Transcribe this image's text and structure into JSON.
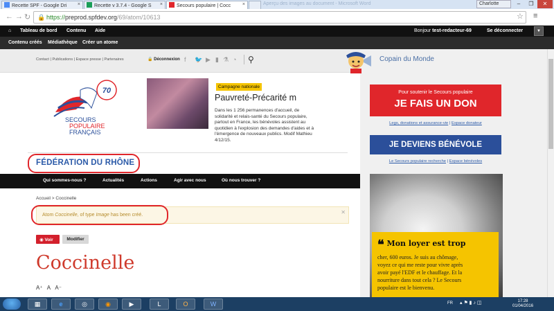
{
  "browser": {
    "tabs": [
      {
        "label": "Recette SPF - Google Dri",
        "active": false
      },
      {
        "label": "Recette v 3.7.4 - Google S",
        "active": false
      },
      {
        "label": "Secours populaire | Cocc",
        "active": true
      }
    ],
    "ghost_title": "Aperçu des images au document - Microsoft Word",
    "window_user": "Charlotte",
    "url_scheme": "https://",
    "url_host": "preprod.spfdev.org",
    "url_path": "/69/atom/10613"
  },
  "admin_bar": {
    "dashboard": "Tableau de bord",
    "content": "Contenu",
    "help": "Aide",
    "greeting": "Bonjour",
    "username": "test-redacteur-69",
    "logout": "Se déconnecter"
  },
  "admin_sub": {
    "created": "Contenu créés",
    "media": "Médiathèque",
    "create_atom": "Créer un atome"
  },
  "utility": {
    "links": "Contact  |  Publications  |  Espace presse  |  Partenaires",
    "logout": "Déconnexion",
    "copain": "Copain du Monde"
  },
  "news": {
    "badge": "Campagne nationale",
    "title": "Pauvreté-Précarité m",
    "body": [
      "Dans les 1 256 permanences d'accueil, de",
      "solidarité et relais-santé du Secours populaire,",
      "partout en France, les bénévoles assistent au",
      "quotidien à l'explosion des demandes d'aides et à",
      "l'émergence de nouveaux publics. Modif Mathieu",
      "4/12/15."
    ]
  },
  "federation": "FÉDÉRATION DU RHÔNE",
  "main_nav": [
    "Qui sommes-nous ?",
    "Actualités",
    "Actions",
    "Agir avec nous",
    "Où nous trouver ?"
  ],
  "breadcrumb": {
    "home": "Accueil",
    "sep": ">",
    "current": "Coccinelle"
  },
  "alert": {
    "prefix": "Atom ",
    "name": "Coccinelle",
    "mid": ", of type ",
    "type": "Image",
    "suffix": " has been créé."
  },
  "actions": {
    "view": "Voir",
    "edit": "Modifier"
  },
  "page_title": "Coccinelle",
  "font_controls": {
    "larger": "A⁺",
    "normal": "A",
    "smaller": "A⁻"
  },
  "sidebar": {
    "don_small": "Pour soutenir le Secours populaire",
    "don_big": "JE FAIS UN DON",
    "don_link1": "Legs, donations et assurance-vie",
    "don_link2": "Espace donateur",
    "benevole": "JE DEVIENS BÉNÉVOLE",
    "ben_link1": "Le Secours populaire recherche",
    "ben_link2": "Espace bénévoles",
    "loyer_title": "Mon loyer est trop",
    "loyer_text": [
      "cher, 600 euros. Je suis au chômage,",
      "voyez ce qui me reste pour vivre après",
      "avoir payé l'EDF et le chauffage. Et la",
      "nourriture dans tout cela ? Le Secours",
      "populaire est le bienvenu."
    ]
  },
  "taskbar": {
    "lang": "FR",
    "time": "17:28",
    "date": "01/04/2016"
  },
  "colors": {
    "red": "#e0262b",
    "blue": "#2b4f9a",
    "yellow": "#f5c400",
    "title_red": "#cf3a2c"
  }
}
